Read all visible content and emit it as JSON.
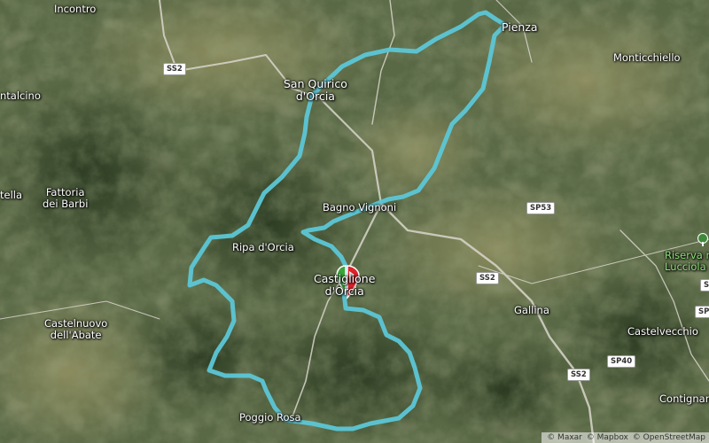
{
  "places": [
    {
      "key": "incontro",
      "text": "Incontro",
      "cls": "place"
    },
    {
      "key": "montalcino",
      "text": "ntalcino",
      "cls": "place"
    },
    {
      "key": "san_quirico",
      "text": "San Quirico\nd'Orcia",
      "cls": "place town"
    },
    {
      "key": "pienza",
      "text": "Pienza",
      "cls": "place town"
    },
    {
      "key": "monticchiello",
      "text": "Monticchiello",
      "cls": "place"
    },
    {
      "key": "stella",
      "text": "tella",
      "cls": "place"
    },
    {
      "key": "fattoria",
      "text": "Fattoria\ndei Barbi",
      "cls": "place"
    },
    {
      "key": "bagno_vignoni",
      "text": "Bagno Vignoni",
      "cls": "place"
    },
    {
      "key": "ripa",
      "text": "Ripa d'Orcia",
      "cls": "place"
    },
    {
      "key": "castiglione",
      "text": "Castiglione\nd'Orcia",
      "cls": "place town"
    },
    {
      "key": "castelnuovo",
      "text": "Castelnuovo\ndell'Abate",
      "cls": "place"
    },
    {
      "key": "gallina",
      "text": "Gallina",
      "cls": "place"
    },
    {
      "key": "castelvecchio",
      "text": "Castelvecchio",
      "cls": "place"
    },
    {
      "key": "contignano",
      "text": "Contignan",
      "cls": "place"
    },
    {
      "key": "poggio_rosa",
      "text": "Poggio Rosa",
      "cls": "place"
    },
    {
      "key": "riserva",
      "text": "Riserva na\nLucciola",
      "cls": "place park"
    }
  ],
  "roads": [
    {
      "key": "ss2_a",
      "text": "SS2"
    },
    {
      "key": "sp53",
      "text": "SP53"
    },
    {
      "key": "ss2_b",
      "text": "SS2"
    },
    {
      "key": "sp40",
      "text": "SP40"
    },
    {
      "key": "ss2_c",
      "text": "SS2"
    },
    {
      "key": "sp_e1",
      "text": "SP"
    },
    {
      "key": "sp_e2",
      "text": "SP"
    }
  ],
  "attribution": [
    "© Maxar",
    "© Mapbox",
    "© OpenStreetMap"
  ],
  "colors": {
    "route": "#5cc6d6",
    "start": "#3aa53a",
    "finish": "#e0232a",
    "road": "#d9d6cc"
  },
  "icons": {
    "park": "tree-icon",
    "start": "start-flag-icon",
    "finish": "finish-flag-icon"
  }
}
